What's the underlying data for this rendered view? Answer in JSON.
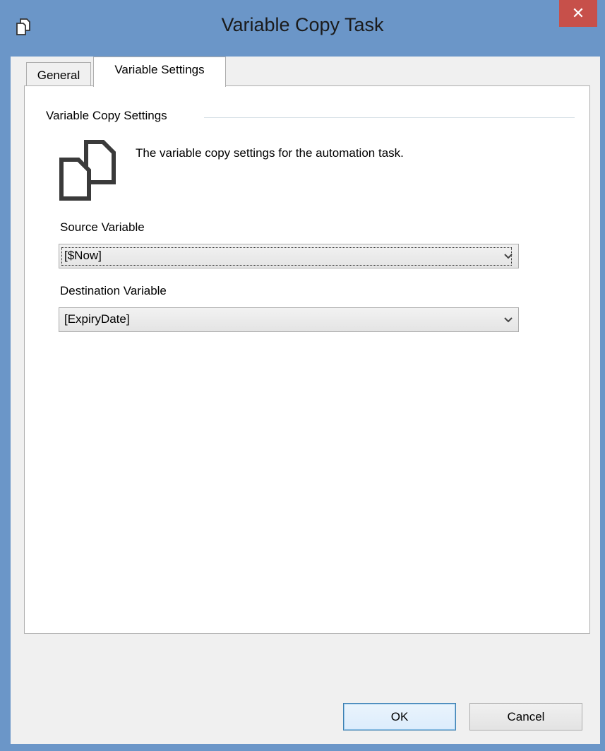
{
  "window": {
    "title": "Variable Copy Task",
    "close_glyph": "✕",
    "app_icon": "copy-icon",
    "accent_color": "#6b96c8",
    "close_color": "#c7504a"
  },
  "tabs": [
    {
      "label": "General",
      "selected": false
    },
    {
      "label": "Variable Settings",
      "selected": true
    }
  ],
  "panel": {
    "group_title": "Variable Copy Settings",
    "icon": "copy-documents-icon",
    "description": "The variable copy settings for the automation task.",
    "source": {
      "label": "Source Variable",
      "value": "[$Now]"
    },
    "destination": {
      "label": "Destination Variable",
      "value": "[ExpiryDate]"
    }
  },
  "buttons": {
    "ok": "OK",
    "cancel": "Cancel"
  }
}
